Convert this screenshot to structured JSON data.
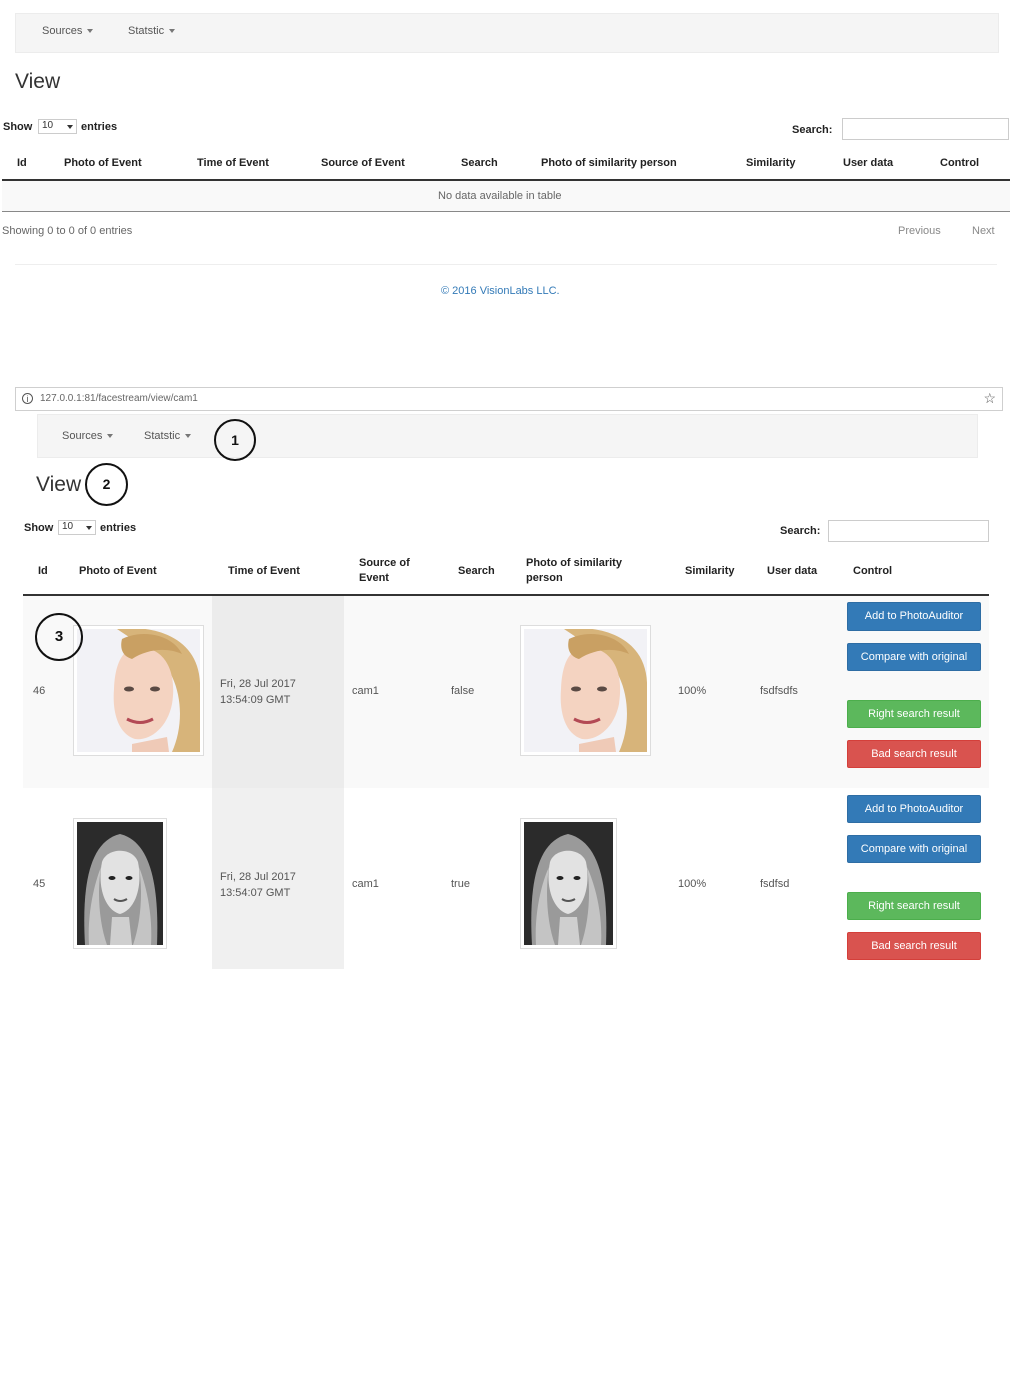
{
  "top": {
    "nav": {
      "sources": "Sources",
      "statistic": "Statstic"
    },
    "title": "View",
    "show_label": "Show",
    "entries_value": "10",
    "entries_label": "entries",
    "search_label": "Search:",
    "columns": [
      "Id",
      "Photo of Event",
      "Time of Event",
      "Source of Event",
      "Search",
      "Photo of similarity person",
      "Similarity",
      "User data",
      "Control"
    ],
    "empty_message": "No data available in table",
    "info": "Showing 0 to 0 of 0 entries",
    "previous": "Previous",
    "next": "Next",
    "footer": "© 2016 VisionLabs LLC."
  },
  "browser": {
    "url": "127.0.0.1:81/facestream/view/cam1",
    "bookmark_icon": "star-icon",
    "info_icon": "info-icon"
  },
  "bottom": {
    "nav": {
      "sources": "Sources",
      "statistic": "Statstic"
    },
    "title": "View",
    "show_label": "Show",
    "entries_value": "10",
    "entries_label": "entries",
    "search_label": "Search:",
    "columns": {
      "id": "Id",
      "photo_event": "Photo of Event",
      "time_event": "Time of Event",
      "source_event": "Source of Event",
      "search": "Search",
      "photo_similar": "Photo of similarity person",
      "similarity": "Similarity",
      "user_data": "User data",
      "control": "Control"
    },
    "rows": [
      {
        "id": "46",
        "time": "Fri, 28 Jul 2017 13:54:09 GMT",
        "source": "cam1",
        "search": "false",
        "similarity": "100%",
        "user_data": "fsdfsdfs"
      },
      {
        "id": "45",
        "time": "Fri, 28 Jul 2017 13:54:07 GMT",
        "source": "cam1",
        "search": "true",
        "similarity": "100%",
        "user_data": "fsdfsd"
      }
    ],
    "buttons": {
      "add": "Add to PhotoAuditor",
      "compare": "Compare with original",
      "right": "Right search result",
      "bad": "Bad search result"
    }
  },
  "callouts": [
    "1",
    "2",
    "3"
  ],
  "colors": {
    "primary": "#337ab7",
    "success": "#5cb85c",
    "danger": "#d9534f",
    "link": "#337ab7"
  }
}
